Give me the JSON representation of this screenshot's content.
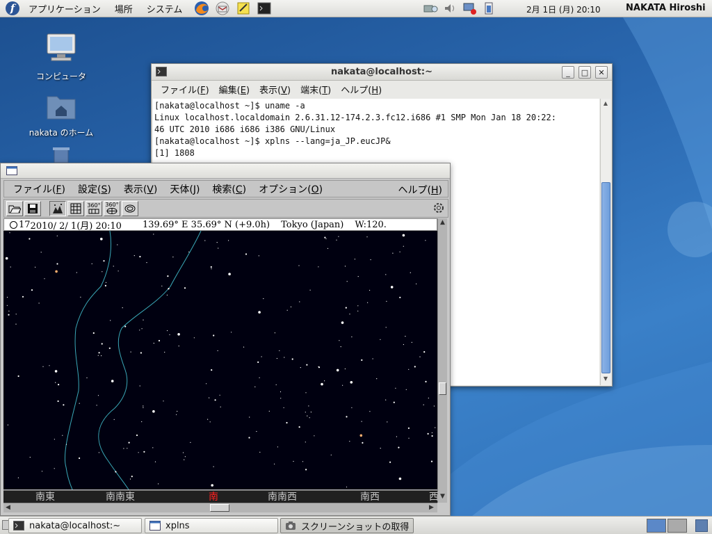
{
  "top_panel": {
    "menus": [
      "アプリケーション",
      "場所",
      "システム"
    ],
    "launchers": [
      "firefox-icon",
      "mail-icon",
      "notes-icon",
      "terminal-icon"
    ],
    "clock": "2月 1日 (月) 20:10",
    "user": "NAKATA Hiroshi"
  },
  "desktop": {
    "icons": [
      {
        "label": "コンピュータ",
        "icon": "computer-icon"
      },
      {
        "label": "nakata のホーム",
        "icon": "home-folder-icon"
      },
      {
        "label": "",
        "icon": "trash-icon"
      }
    ]
  },
  "terminal": {
    "title": "nakata@localhost:~",
    "menus": [
      {
        "label": "ファイル",
        "key": "F"
      },
      {
        "label": "編集",
        "key": "E"
      },
      {
        "label": "表示",
        "key": "V"
      },
      {
        "label": "端末",
        "key": "T"
      },
      {
        "label": "ヘルプ",
        "key": "H"
      }
    ],
    "lines": [
      "[nakata@localhost ~]$ uname -a",
      "Linux localhost.localdomain 2.6.31.12-174.2.3.fc12.i686 #1 SMP Mon Jan 18 20:22:",
      "46 UTC 2010 i686 i686 i386 GNU/Linux",
      "[nakata@localhost ~]$ xplns --lang=ja_JP.eucJP&",
      "[1] 1808"
    ]
  },
  "xplns": {
    "menus": [
      {
        "label": "ファイル",
        "key": "F"
      },
      {
        "label": "設定",
        "key": "S"
      },
      {
        "label": "表示",
        "key": "V"
      },
      {
        "label": "天体",
        "key": "J"
      },
      {
        "label": "検索",
        "key": "C"
      },
      {
        "label": "オプション",
        "key": "O"
      }
    ],
    "help_menu": {
      "label": "ヘルプ",
      "key": "H"
    },
    "toolbar": [
      "open-icon",
      "save-icon",
      "mode-icon",
      "grid-icon",
      "360-icon",
      "360-globe-icon",
      "zoom-icon"
    ],
    "toolbar_small_labels": {
      "full": "360°",
      "globe": "360°"
    },
    "status": {
      "moon_age": "17",
      "date": "2010/ 2/ 1(月) 20:10",
      "coords": "139.69° E 35.69° N (+9.0h)",
      "place": "Tokyo (Japan)",
      "view": "W:120."
    },
    "directions": [
      "南東",
      "南南東",
      "南",
      "南南西",
      "南西",
      "西"
    ],
    "colors": {
      "sky": "#000010",
      "milkyway": "#3aa8b8",
      "south_mark": "#ff2020"
    }
  },
  "taskbar": {
    "tasks": [
      {
        "label": "nakata@localhost:~",
        "icon": "terminal-icon"
      },
      {
        "label": "xplns",
        "icon": "window-icon"
      },
      {
        "label": "スクリーンショットの取得",
        "icon": "camera-icon"
      }
    ]
  }
}
